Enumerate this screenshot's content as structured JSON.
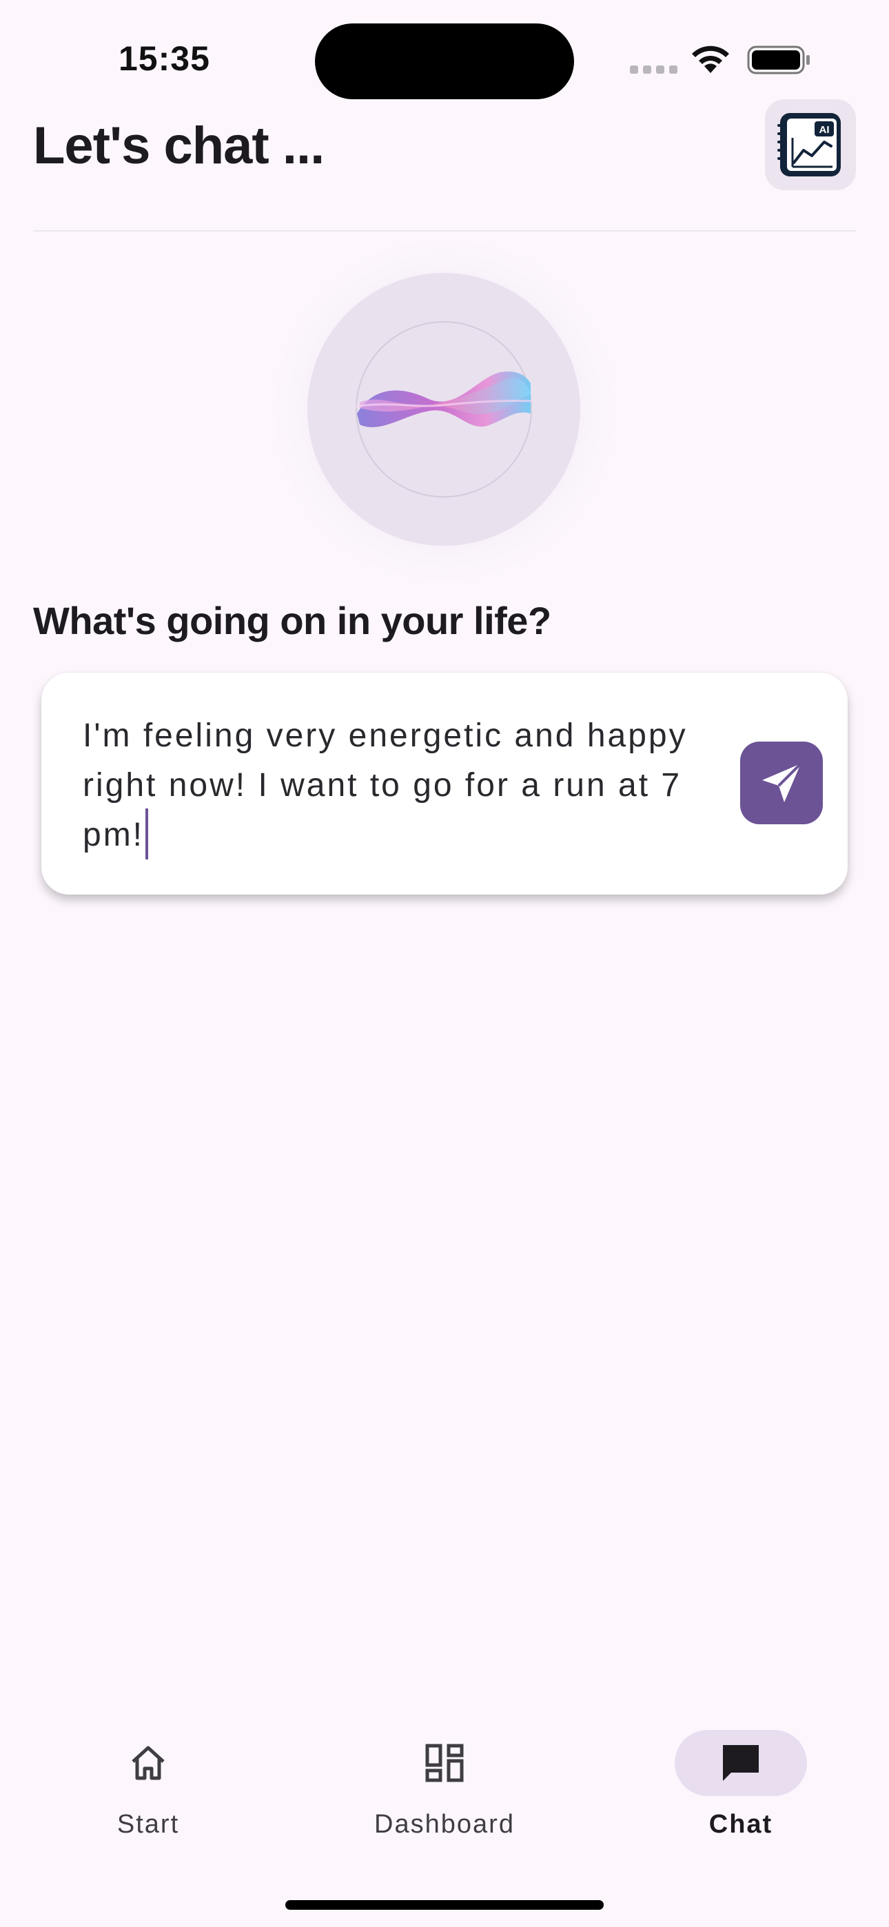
{
  "status_bar": {
    "time": "15:35"
  },
  "header": {
    "title": "Let's chat ...",
    "ai_button_icon": "ai-analytics-icon",
    "ai_badge": "AI"
  },
  "orb": {
    "icon": "ai-wave-orb"
  },
  "prompt": {
    "question": "What's going on in your life?",
    "input_value": "I'm feeling very energetic and happy right now! I want to go for a run at 7 pm!",
    "send_icon": "send-icon"
  },
  "bottom_nav": {
    "items": [
      {
        "label": "Start",
        "icon": "home-icon",
        "active": false
      },
      {
        "label": "Dashboard",
        "icon": "dashboard-icon",
        "active": false
      },
      {
        "label": "Chat",
        "icon": "chat-icon",
        "active": true
      }
    ]
  },
  "colors": {
    "background": "#fdf7fd",
    "accent": "#6b5395",
    "active_pill": "#e9def0",
    "ai_button_bg": "#ece4ee"
  }
}
